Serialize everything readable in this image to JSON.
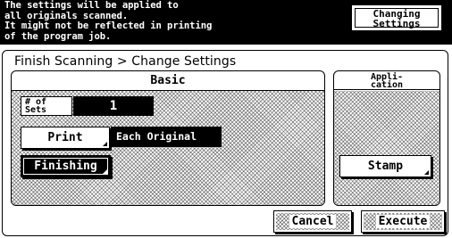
{
  "header": {
    "message": "The settings will be applied to\nall originals scanned.\nIt might not be reflected in printing\nof the program job.",
    "mode_badge": "Changing\nSettings"
  },
  "breadcrumb": "Finish Scanning > Change Settings",
  "basic": {
    "heading": "Basic",
    "sets_label": "# of\nSets",
    "sets_value": "1",
    "print_label": "Print",
    "print_value": "Each Original",
    "finishing_label": "Finishing"
  },
  "application": {
    "heading": "Appli-\ncation",
    "stamp_label": "Stamp"
  },
  "footer": {
    "cancel_label": "Cancel",
    "execute_label": "Execute"
  }
}
